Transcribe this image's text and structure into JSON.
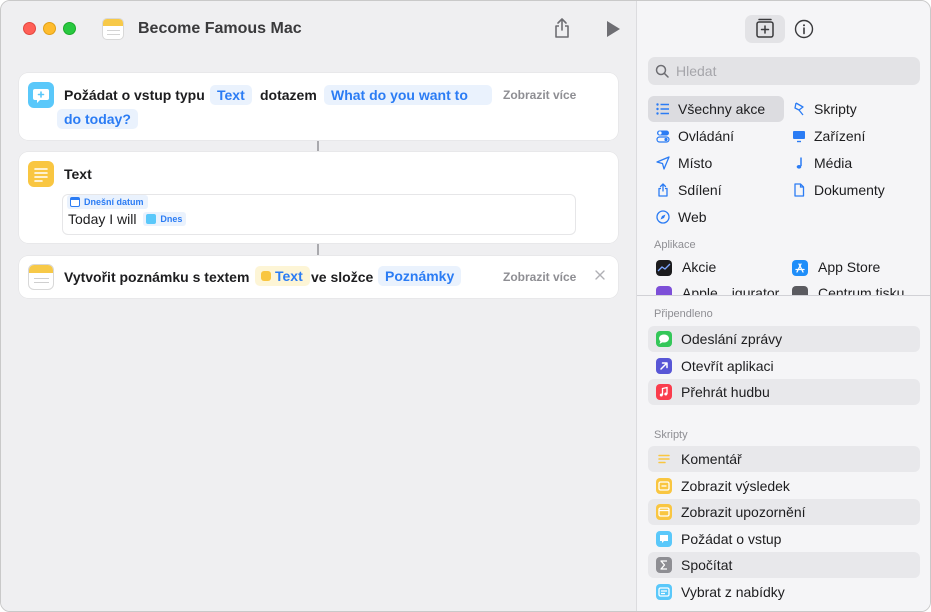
{
  "window": {
    "title": "Become Famous Mac"
  },
  "actions": [
    {
      "label": "Požádat o vstup typu",
      "type_token": "Text",
      "middle": "dotazem",
      "prompt_line1": "What do you want to",
      "prompt_line2": "do today?",
      "more": "Zobrazit více"
    },
    {
      "label": "Text",
      "variable": "Dnešní datum",
      "content": "Today I will",
      "inline_token": "Dnes"
    },
    {
      "label": "Vytvořit poznámku s textem",
      "text_token": "Text",
      "middle": "ve složce",
      "folder_token": "Poznámky",
      "more": "Zobrazit více"
    }
  ],
  "sidebar": {
    "search_placeholder": "Hledat",
    "categories": [
      {
        "label": "Všechny akce",
        "icon": "list-icon"
      },
      {
        "label": "Skripty",
        "icon": "script-icon"
      },
      {
        "label": "Ovládání",
        "icon": "toggle-icon"
      },
      {
        "label": "Zařízení",
        "icon": "display-icon"
      },
      {
        "label": "Místo",
        "icon": "location-icon"
      },
      {
        "label": "Média",
        "icon": "music-note-icon"
      },
      {
        "label": "Sdílení",
        "icon": "share-icon"
      },
      {
        "label": "Dokumenty",
        "icon": "document-icon"
      },
      {
        "label": "Web",
        "icon": "compass-icon"
      }
    ],
    "apps_header": "Aplikace",
    "apps": [
      {
        "label": "Akcie",
        "icon": "stocks-icon"
      },
      {
        "label": "App Store",
        "icon": "app-store-icon"
      },
      {
        "label": "Apple…igurator",
        "icon": "configurator-icon"
      },
      {
        "label": "Centrum tisku",
        "icon": "printer-icon"
      }
    ],
    "pinned_header": "Připendleno",
    "pinned": [
      {
        "label": "Odeslání zprávy",
        "icon": "messages-icon"
      },
      {
        "label": "Otevřít aplikaci",
        "icon": "open-app-icon"
      },
      {
        "label": "Přehrát hudbu",
        "icon": "music-icon"
      }
    ],
    "scripts_header": "Skripty",
    "scripts": [
      {
        "label": "Komentář",
        "icon": "comment-icon"
      },
      {
        "label": "Zobrazit výsledek",
        "icon": "show-result-icon"
      },
      {
        "label": "Zobrazit upozornění",
        "icon": "alert-icon"
      },
      {
        "label": "Požádat o vstup",
        "icon": "ask-input-icon"
      },
      {
        "label": "Spočítat",
        "icon": "sigma-icon"
      },
      {
        "label": "Vybrat z nabídky",
        "icon": "menu-icon"
      }
    ]
  }
}
